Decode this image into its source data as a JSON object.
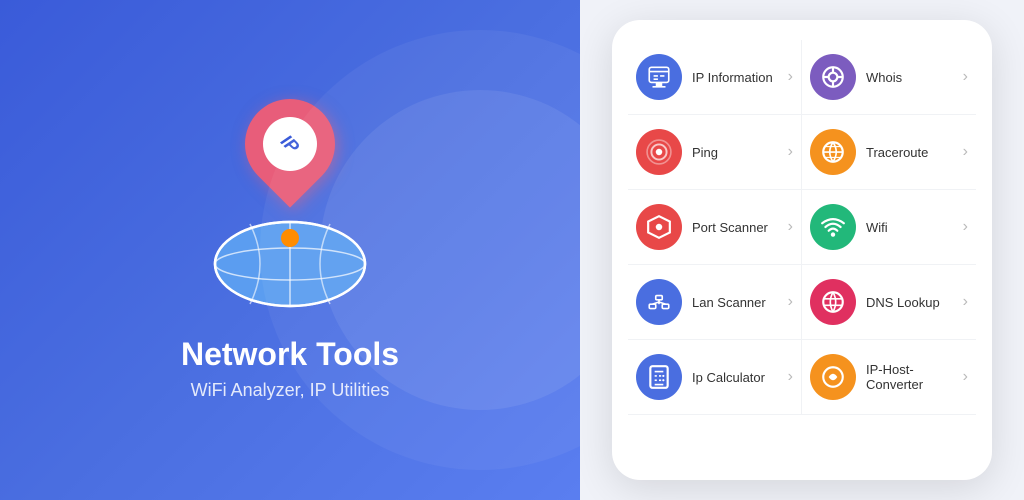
{
  "left": {
    "title": "Network Tools",
    "subtitle": "WiFi Analyzer, IP Utilities"
  },
  "right": {
    "menu_items": [
      {
        "id": "ip-information",
        "label": "IP Information",
        "icon_color": "bg-blue",
        "icon_type": "ip-info"
      },
      {
        "id": "whois",
        "label": "Whois",
        "icon_color": "bg-purple",
        "icon_type": "whois"
      },
      {
        "id": "ping",
        "label": "Ping",
        "icon_color": "bg-red",
        "icon_type": "ping"
      },
      {
        "id": "traceroute",
        "label": "Traceroute",
        "icon_color": "bg-orange",
        "icon_type": "traceroute"
      },
      {
        "id": "port-scanner",
        "label": "Port Scanner",
        "icon_color": "bg-red",
        "icon_type": "port-scanner"
      },
      {
        "id": "wifi",
        "label": "Wifi",
        "icon_color": "bg-green",
        "icon_type": "wifi"
      },
      {
        "id": "lan-scanner",
        "label": "Lan Scanner",
        "icon_color": "bg-blue",
        "icon_type": "lan-scanner"
      },
      {
        "id": "dns-lookup",
        "label": "DNS Lookup",
        "icon_color": "bg-crimson",
        "icon_type": "dns-lookup"
      },
      {
        "id": "ip-calculator",
        "label": "Ip Calculator",
        "icon_color": "bg-blue",
        "icon_type": "ip-calculator"
      },
      {
        "id": "ip-host-converter",
        "label": "IP-Host-Converter",
        "icon_color": "bg-amber",
        "icon_type": "ip-host-converter"
      }
    ]
  }
}
